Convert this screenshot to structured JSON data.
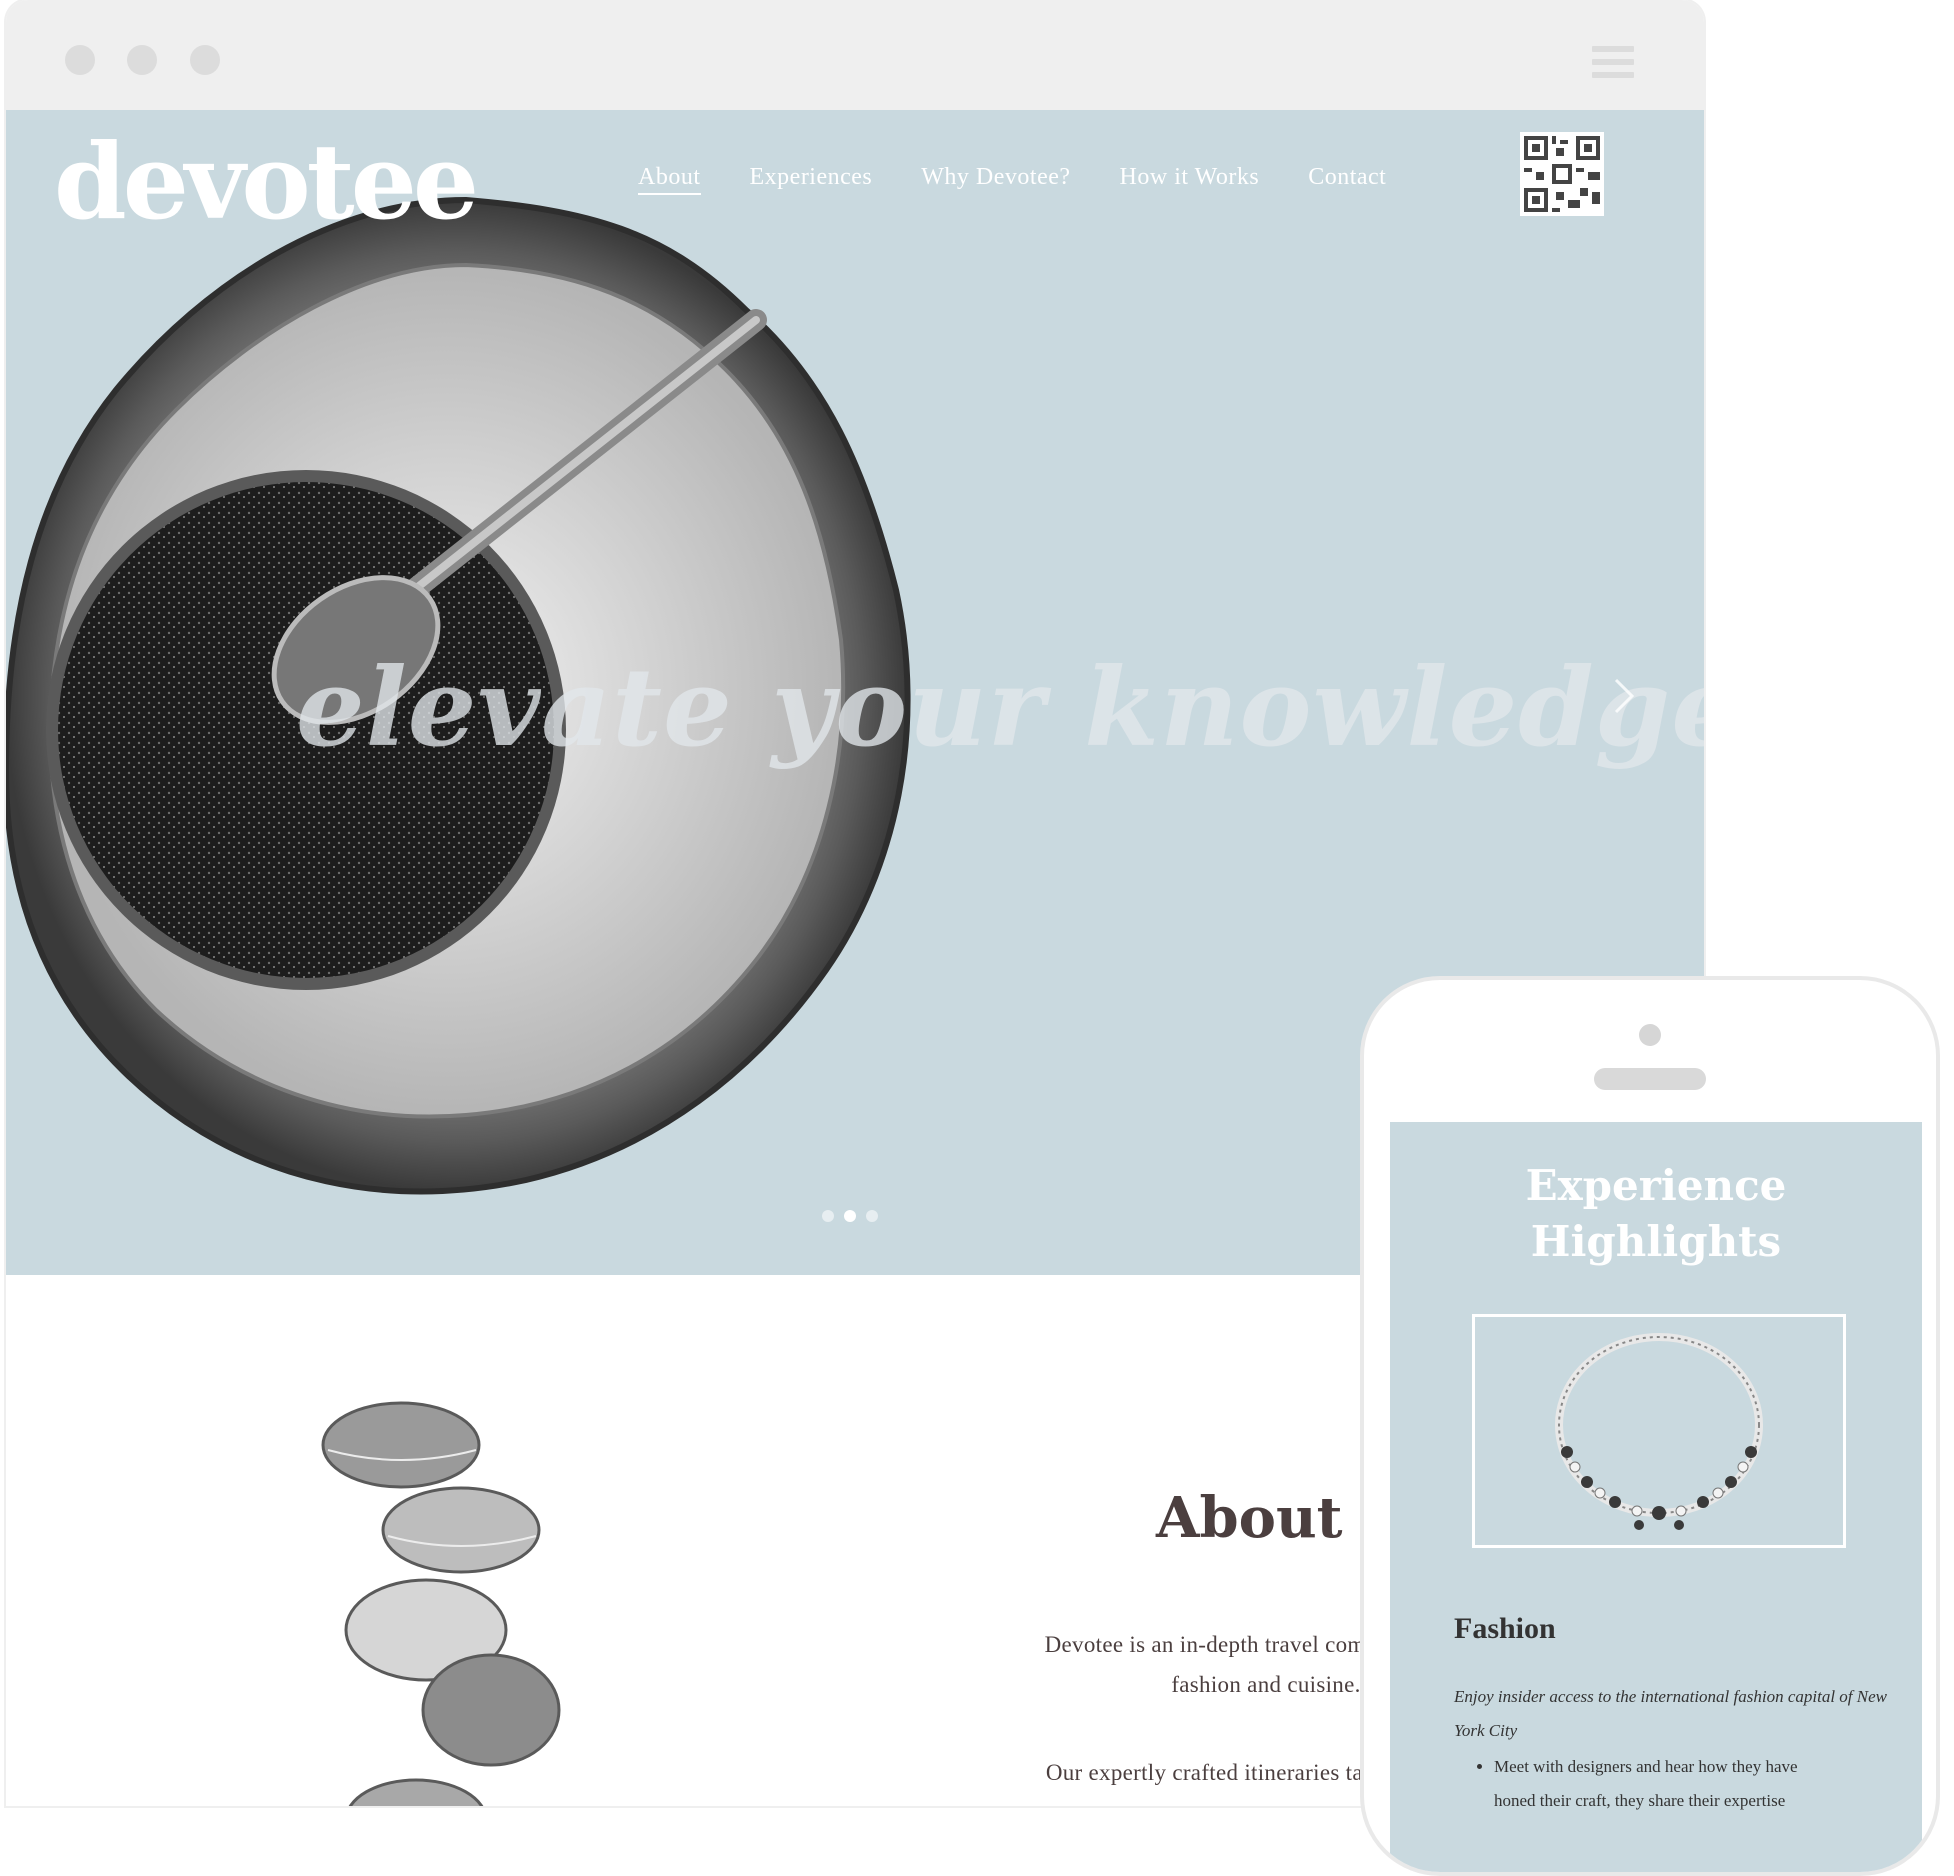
{
  "site": {
    "logo": "devotee",
    "nav": [
      "About",
      "Experiences",
      "Why Devotee?",
      "How it Works",
      "Contact"
    ],
    "active_nav": "About",
    "tagline": "elevate your knowledge"
  },
  "slider": {
    "slides": 3,
    "active": 2
  },
  "about": {
    "title": "About",
    "p1_line1": "Devotee is an in-depth travel company focusin",
    "p1_line2": "fashion and cuisine.",
    "p2_line1": "Our expertly crafted itineraries take you to the"
  },
  "phone": {
    "title_line1": "Experience",
    "title_line2": "Highlights",
    "section": "Fashion",
    "description": "Enjoy insider access to the international fashion capital of New York City",
    "bullet1_line1": "Meet with designers and hear how they have",
    "bullet1_line2": "honed their craft, they share their expertise"
  },
  "colors": {
    "hero_bg": "#c9d9df",
    "browser_chrome": "#efefef",
    "heading": "#4b3f3f"
  }
}
